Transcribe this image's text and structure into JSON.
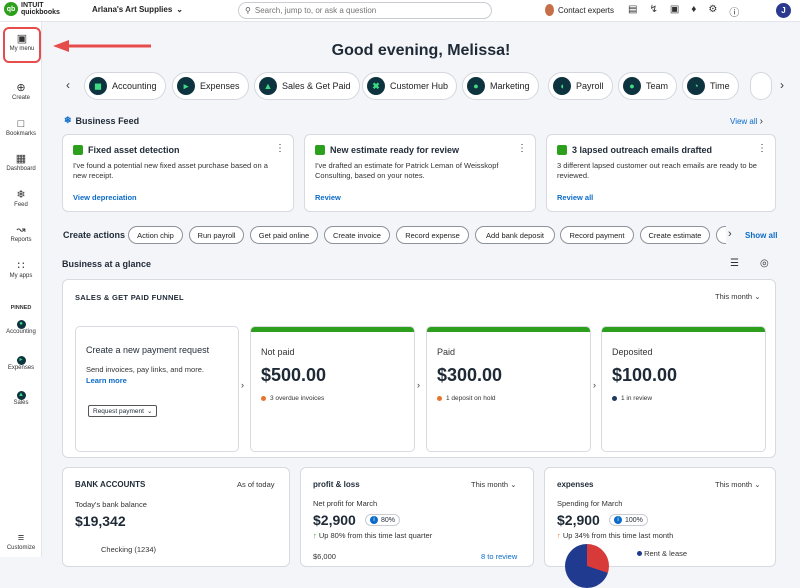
{
  "topbar": {
    "logo_top": "INTUIT",
    "logo_bottom": "quickbooks",
    "company": "Arlana's Art Supplies",
    "search_placeholder": "Search, jump to, or ask a question",
    "experts": "Contact experts",
    "avatar_initial": "J"
  },
  "sidebar": {
    "my_menu": "My menu",
    "items": [
      "Create",
      "Bookmarks",
      "Dashboard",
      "Feed",
      "Reports",
      "My apps"
    ],
    "pinned_label": "PINNED",
    "pinned": [
      "Accounting",
      "Expenses",
      "Sales"
    ],
    "customize": "Customize"
  },
  "greeting": "Good evening, Melissa!",
  "apps": [
    "Accounting",
    "Expenses",
    "Sales & Get Paid",
    "Customer Hub",
    "Marketing",
    "Payroll",
    "Team",
    "Time"
  ],
  "feed": {
    "title": "Business Feed",
    "view_all": "View all",
    "cards": [
      {
        "title": "Fixed asset detection",
        "body": "I've found a potential new fixed asset purchase based on a new receipt.",
        "link": "View depreciation"
      },
      {
        "title": "New estimate ready for review",
        "body": "I've drafted an estimate for Patrick Leman of Weisskopf Consulting, based on your notes.",
        "link": "Review"
      },
      {
        "title": "3 lapsed outreach emails drafted",
        "body": "3 different lapsed customer out reach emails are ready to be reviewed.",
        "link": "Review all"
      }
    ]
  },
  "create_actions": {
    "label": "Create actions",
    "show_all": "Show all",
    "chips": [
      "Action chip",
      "Run payroll",
      "Get paid online",
      "Create invoice",
      "Record expense",
      "Add bank deposit",
      "Record payment",
      "Create estimate"
    ]
  },
  "glance": {
    "title": "Business at a glance",
    "funnel": {
      "title": "SALES & GET PAID FUNNEL",
      "period": "This month",
      "request": {
        "title": "Create a new payment request",
        "body": "Send invoices, pay links, and more.",
        "link": "Learn more",
        "button": "Request payment"
      },
      "stages": [
        {
          "label": "Not paid",
          "value": "$500.00",
          "note": "3 overdue invoices",
          "color": "#2ca01c",
          "dot": "#e8732c"
        },
        {
          "label": "Paid",
          "value": "$300.00",
          "note": "1 deposit on hold",
          "color": "#2ca01c",
          "dot": "#e8732c"
        },
        {
          "label": "Deposited",
          "value": "$100.00",
          "note": "1 in review",
          "color": "#2ca01c",
          "dot": "#1f3a5f"
        }
      ]
    }
  },
  "bank": {
    "title": "BANK ACCOUNTS",
    "as_of": "As of today",
    "label": "Today's bank balance",
    "value": "$19,342",
    "account": "Checking (1234)"
  },
  "pnl": {
    "title": "profit & loss",
    "period": "This month",
    "label": "Net profit for March",
    "value": "$2,900",
    "pct": "80%",
    "trend": "Up 80% from this time last quarter",
    "sub": "$6,000",
    "review": "8 to review"
  },
  "expenses": {
    "title": "expenses",
    "period": "This month",
    "label": "Spending for March",
    "value": "$2,900",
    "pct": "100%",
    "trend": "Up 34% from this time last month",
    "legend": "Rent & lease"
  }
}
